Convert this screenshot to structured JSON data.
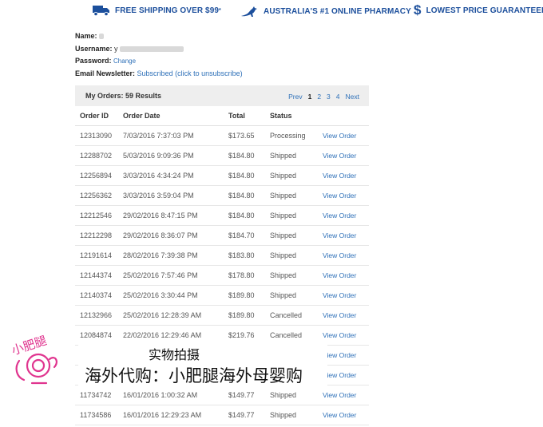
{
  "banner": {
    "shipping": "FREE SHIPPING OVER $99",
    "shipping_sup": "*",
    "australia": "AUSTRALIA'S #1 ONLINE PHARMACY",
    "price": "LOWEST PRICE GUARANTEED",
    "colors": {
      "brand_blue": "#1c4f9c"
    }
  },
  "account": {
    "name_label": "Name:",
    "username_label": "Username:",
    "username_visible": "y",
    "password_label": "Password:",
    "change_link": "Change",
    "newsletter_label": "Email Newsletter:",
    "newsletter_status": "Subscribed (click to unsubscribe)"
  },
  "orders": {
    "title": "My Orders: 59 Results",
    "pager": {
      "prev": "Prev",
      "pages": [
        "1",
        "2",
        "3",
        "4"
      ],
      "current": "1",
      "next": "Next"
    },
    "columns": [
      "Order ID",
      "Order Date",
      "Total",
      "Status"
    ],
    "action_label": "View Order",
    "rows": [
      {
        "id": "12313090",
        "date": "7/03/2016 7:37:03 PM",
        "total": "$173.65",
        "status": "Processing"
      },
      {
        "id": "12288702",
        "date": "5/03/2016 9:09:36 PM",
        "total": "$184.80",
        "status": "Shipped"
      },
      {
        "id": "12256894",
        "date": "3/03/2016 4:34:24 PM",
        "total": "$184.80",
        "status": "Shipped"
      },
      {
        "id": "12256362",
        "date": "3/03/2016 3:59:04 PM",
        "total": "$184.80",
        "status": "Shipped"
      },
      {
        "id": "12212546",
        "date": "29/02/2016 8:47:15 PM",
        "total": "$184.80",
        "status": "Shipped"
      },
      {
        "id": "12212298",
        "date": "29/02/2016 8:36:07 PM",
        "total": "$184.70",
        "status": "Shipped"
      },
      {
        "id": "12191614",
        "date": "28/02/2016 7:39:38 PM",
        "total": "$183.80",
        "status": "Shipped"
      },
      {
        "id": "12144374",
        "date": "25/02/2016 7:57:46 PM",
        "total": "$178.80",
        "status": "Shipped"
      },
      {
        "id": "12140374",
        "date": "25/02/2016 3:30:44 PM",
        "total": "$189.80",
        "status": "Shipped"
      },
      {
        "id": "12132966",
        "date": "25/02/2016 12:28:39 AM",
        "total": "$189.80",
        "status": "Cancelled"
      },
      {
        "id": "12084874",
        "date": "22/02/2016 12:29:46 AM",
        "total": "$219.76",
        "status": "Cancelled"
      },
      {
        "id": "",
        "date": "",
        "total": "",
        "status": ""
      },
      {
        "id": "",
        "date": "",
        "total": "",
        "status": ""
      },
      {
        "id": "11734742",
        "date": "16/01/2016 1:00:32 AM",
        "total": "$149.77",
        "status": "Shipped"
      },
      {
        "id": "11734586",
        "date": "16/01/2016 12:29:23 AM",
        "total": "$149.77",
        "status": "Shipped"
      }
    ]
  },
  "watermark": {
    "line1": "实物拍摄",
    "line2": "海外代购：小肥腿海外母婴购",
    "logo_text": "小肥腿",
    "logo_color": "#e0358f"
  }
}
